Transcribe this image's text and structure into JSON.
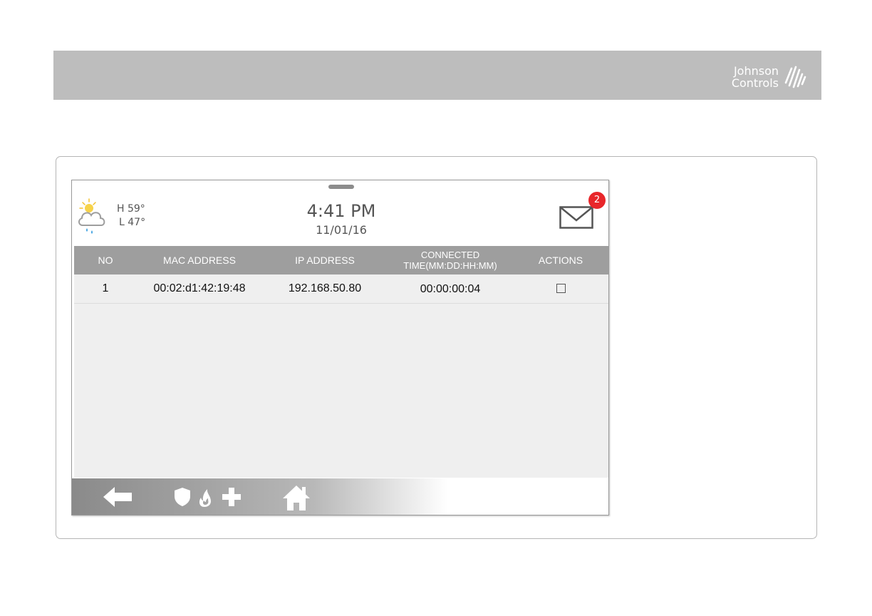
{
  "brand": {
    "line1": "Johnson",
    "line2": "Controls"
  },
  "status": {
    "high_temp": "H 59°",
    "low_temp": "L 47°",
    "time": "4:41 PM",
    "date": "11/01/16",
    "message_count": "2",
    "weather_icon": "partly-cloudy-rain-icon"
  },
  "table": {
    "headers": {
      "no": "NO",
      "mac": "MAC ADDRESS",
      "ip": "IP ADDRESS",
      "time_line1": "CONNECTED",
      "time_line2": "TIME(MM:DD:HH:MM)",
      "actions": "ACTIONS"
    },
    "rows": [
      {
        "no": "1",
        "mac": "00:02:d1:42:19:48",
        "ip": "192.168.50.80",
        "time": "00:00:00:04",
        "selected": false
      }
    ]
  },
  "footer": {
    "icons": [
      "back-arrow-icon",
      "shield-icon",
      "fire-icon",
      "medical-cross-icon",
      "home-icon"
    ]
  },
  "colors": {
    "header_bar": "#bdbdbd",
    "table_header": "#9e9e9e",
    "badge": "#e8262a"
  }
}
